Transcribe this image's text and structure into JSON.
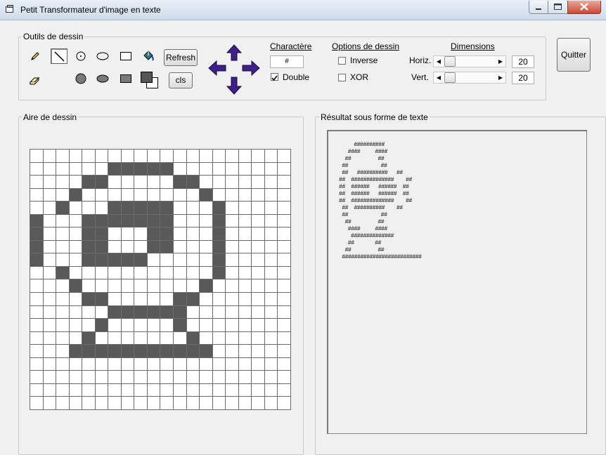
{
  "window": {
    "title": "Petit Transformateur d'image en texte"
  },
  "tools": {
    "group_label": "Outils de dessin",
    "refresh_label": "Refresh",
    "cls_label": "cls",
    "selected_tool": "line",
    "items": [
      "pencil-icon",
      "line-icon",
      "circle-center-icon",
      "ellipse-outline-icon",
      "rectangle-outline-icon",
      "fill-bucket-icon",
      "eraser-icon",
      "circle-filled-icon",
      "ellipse-filled-icon",
      "rectangle-filled-icon",
      "color-swatch-icon"
    ]
  },
  "arrows": [
    "up-arrow-icon",
    "left-arrow-icon",
    "right-arrow-icon",
    "down-arrow-icon"
  ],
  "character": {
    "title": "Charactère",
    "value": "#",
    "double_label": "Double",
    "double_checked": true
  },
  "options": {
    "title": "Options de dessin",
    "inverse_label": "Inverse",
    "inverse_checked": false,
    "xor_label": "XOR",
    "xor_checked": false
  },
  "dimensions": {
    "title": "Dimensions",
    "horiz_label": "Horiz.",
    "horiz_value": "20",
    "vert_label": "Vert.",
    "vert_value": "20"
  },
  "quit_label": "Quitter",
  "canvas": {
    "label": "Aire de dessin",
    "rows": [
      "....................",
      "......#####.........",
      "....##.....##.......",
      "...#.........#......",
      "..#...#####...#.....",
      "#...#######...#.....",
      "#...##...##...#.....",
      "#...##...##...#.....",
      "#...#####.....#.....",
      "..#...........#.....",
      "...#.........#......",
      "....##.....##.......",
      "......######........",
      ".....#.....#........",
      "....#.......#.......",
      "...###########......",
      "....................",
      "....................",
      "....................",
      "...................."
    ]
  },
  "result": {
    "label": "Résultat sous forme de texte",
    "text": "            ##########\n        ####          ####\n      ##                  ##\n    ##                      ##\n    ##      ##########      ##\n  ##    ##############        ##\n  ##    ######      ######    ##\n  ##    ######      ######    ##\n  ##    ##############        ##\n    ##    ##########        ##\n    ##                      ##\n      ##                  ##\n        ####          ####\n          ##############\n        ##              ##\n      ##                  ##\n    ##########################"
  }
}
